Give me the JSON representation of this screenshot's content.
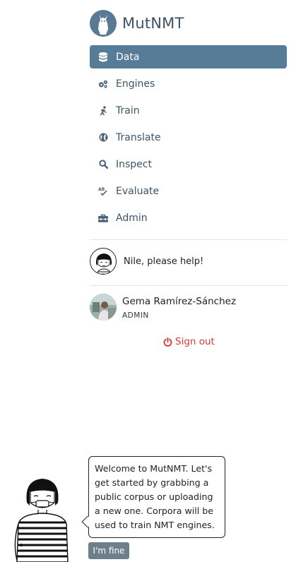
{
  "app": {
    "title": "MutNMT"
  },
  "nav": {
    "items": [
      {
        "label": "Data",
        "icon": "database-icon",
        "active": true
      },
      {
        "label": "Engines",
        "icon": "cogs-icon",
        "active": false
      },
      {
        "label": "Train",
        "icon": "running-icon",
        "active": false
      },
      {
        "label": "Translate",
        "icon": "globe-icon",
        "active": false
      },
      {
        "label": "Inspect",
        "icon": "search-icon",
        "active": false
      },
      {
        "label": "Evaluate",
        "icon": "spell-check-icon",
        "active": false
      },
      {
        "label": "Admin",
        "icon": "toolbox-icon",
        "active": false
      }
    ]
  },
  "help": {
    "label": "Nile, please help!"
  },
  "user": {
    "name": "Gema Ramírez-Sánchez",
    "role": "ADMIN"
  },
  "signout": {
    "label": "Sign out",
    "color": "#d9383a"
  },
  "assistant": {
    "message": "Welcome to MutNMT. Let's get started by grabbing a public corpus or uploading a new one. Corpora will be used to train NMT engines.",
    "dismiss_label": "I'm fine"
  },
  "colors": {
    "accent": "#577c97",
    "text": "#3d5366"
  }
}
